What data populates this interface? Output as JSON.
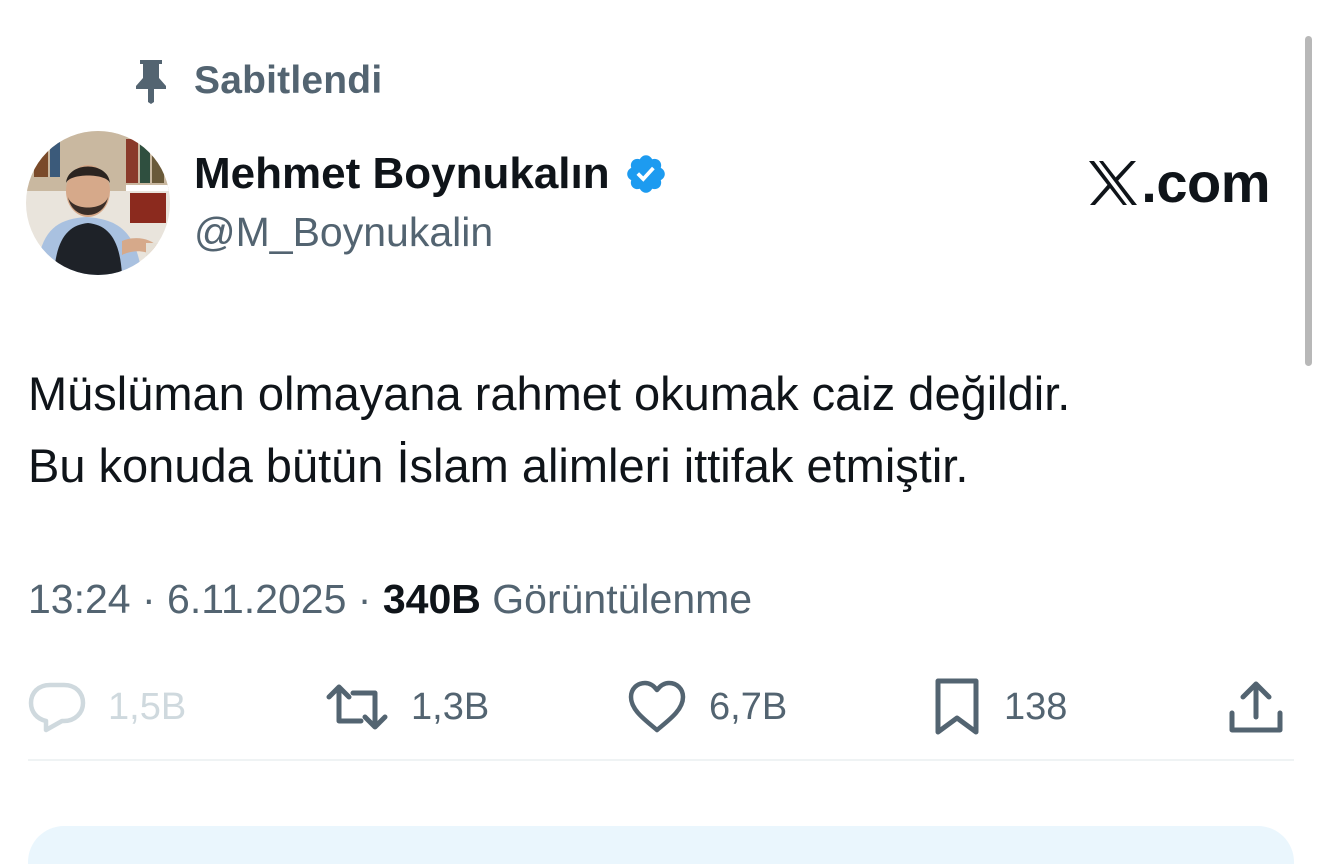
{
  "pinned": {
    "label": "Sabitlendi",
    "icon": "pin-icon"
  },
  "author": {
    "name": "Mehmet Boynukalın",
    "handle": "@M_Boynukalin",
    "verified": true,
    "verified_color": "#1d9bf0"
  },
  "brand": {
    "text": ".com",
    "icon": "x-logo-icon"
  },
  "tweet": {
    "lines": [
      "Müslüman olmayana rahmet okumak caiz değildir.",
      "Bu konuda bütün İslam alimleri ittifak etmiştir."
    ]
  },
  "meta": {
    "time": "13:24",
    "separator": " · ",
    "date": "6.11.2025",
    "views_count": "340B",
    "views_label": "Görüntülenme"
  },
  "actions": {
    "reply": {
      "count": "1,5B",
      "icon": "reply-icon"
    },
    "retweet": {
      "count": "1,3B",
      "icon": "retweet-icon"
    },
    "like": {
      "count": "6,7B",
      "icon": "heart-icon"
    },
    "bookmark": {
      "count": "138",
      "icon": "bookmark-icon"
    },
    "share": {
      "icon": "share-icon"
    }
  },
  "colors": {
    "text_primary": "#0f1419",
    "text_secondary": "#536471",
    "divider": "#eff3f4",
    "card_background": "#eaf6fd"
  }
}
